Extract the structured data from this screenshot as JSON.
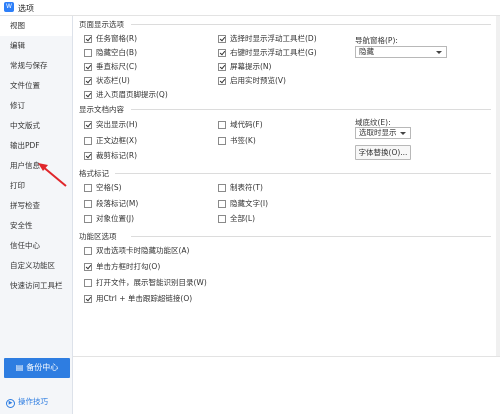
{
  "window": {
    "title": "选项"
  },
  "sidebar": {
    "items": [
      {
        "label": "视图",
        "active": true
      },
      {
        "label": "编辑"
      },
      {
        "label": "常规与保存"
      },
      {
        "label": "文件位置"
      },
      {
        "label": "修订"
      },
      {
        "label": "中文版式"
      },
      {
        "label": "输出PDF"
      },
      {
        "label": "用户信息"
      },
      {
        "label": "打印"
      },
      {
        "label": "拼写检查"
      },
      {
        "label": "安全性"
      },
      {
        "label": "信任中心"
      },
      {
        "label": "自定义功能区"
      },
      {
        "label": "快速访问工具栏"
      }
    ],
    "backup_label": "备份中心",
    "tips_label": "操作技巧"
  },
  "page_display": {
    "title": "页面显示选项",
    "left": [
      {
        "label": "任务窗格(R)",
        "checked": true
      },
      {
        "label": "隐藏空白(B)",
        "checked": false
      },
      {
        "label": "垂直标尺(C)",
        "checked": true
      },
      {
        "label": "状态栏(U)",
        "checked": true
      },
      {
        "label": "进入页眉页脚提示(Q)",
        "checked": true
      }
    ],
    "middle": [
      {
        "label": "选择时显示浮动工具栏(D)",
        "checked": true
      },
      {
        "label": "右键时显示浮动工具栏(G)",
        "checked": true
      },
      {
        "label": "屏幕提示(N)",
        "checked": true
      },
      {
        "label": "启用实时预览(V)",
        "checked": true
      }
    ],
    "nav_pane_label": "导航窗格(P):",
    "nav_pane_value": "隐藏"
  },
  "doc_content": {
    "title": "显示文档内容",
    "left": [
      {
        "label": "突出显示(H)",
        "checked": true
      },
      {
        "label": "正文边框(X)",
        "checked": false
      },
      {
        "label": "裁剪标记(R)",
        "checked": true
      }
    ],
    "middle": [
      {
        "label": "域代码(F)",
        "checked": false
      },
      {
        "label": "书签(K)",
        "checked": false
      }
    ],
    "field_shading_label": "域底纹(E):",
    "field_shading_value": "选取时显示",
    "font_replace_label": "字体替换(O)..."
  },
  "format_marks": {
    "title": "格式标记",
    "left": [
      {
        "label": "空格(S)",
        "checked": false
      },
      {
        "label": "段落标记(M)",
        "checked": false
      },
      {
        "label": "对象位置(J)",
        "checked": false
      }
    ],
    "middle": [
      {
        "label": "制表符(T)",
        "checked": false
      },
      {
        "label": "隐藏文字(I)",
        "checked": false
      },
      {
        "label": "全部(L)",
        "checked": false
      }
    ]
  },
  "function_area": {
    "title": "功能区选项",
    "items": [
      {
        "label": "双击选项卡时隐藏功能区(A)",
        "checked": false
      },
      {
        "label": "单击方框时打勾(O)",
        "checked": true
      },
      {
        "label": "打开文件，展示智能识别目录(W)",
        "checked": false
      },
      {
        "label": "用Ctrl + 单击跟踪超链接(O)",
        "checked": true
      }
    ]
  },
  "colors": {
    "accent": "#2e7de1",
    "arrow": "#e0262b"
  }
}
